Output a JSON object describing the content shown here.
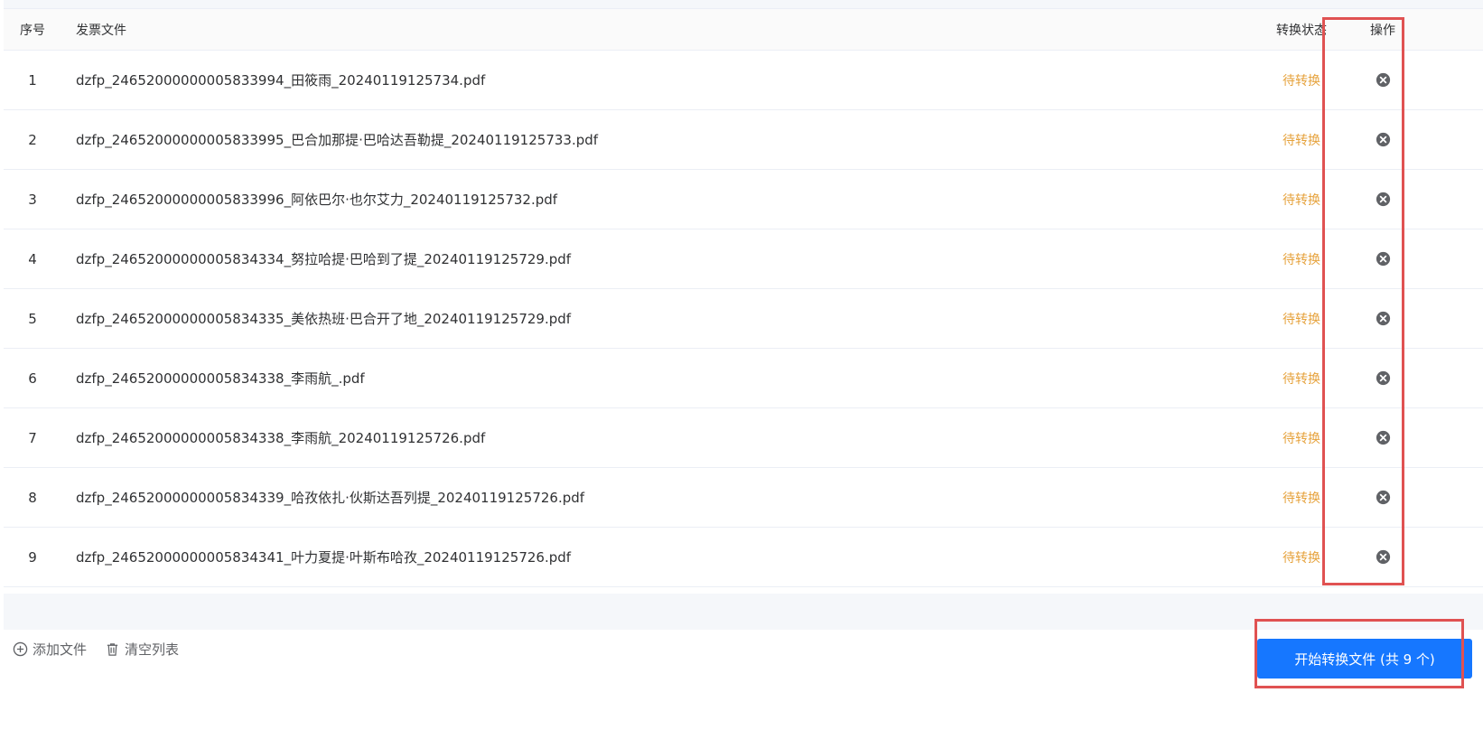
{
  "table": {
    "headers": {
      "index": "序号",
      "file": "发票文件",
      "status": "转换状态",
      "action": "操作"
    },
    "rows": [
      {
        "index": "1",
        "file": "dzfp_24652000000005833994_田筱雨_20240119125734.pdf",
        "status": "待转换"
      },
      {
        "index": "2",
        "file": "dzfp_24652000000005833995_巴合加那提·巴哈达吾勒提_20240119125733.pdf",
        "status": "待转换"
      },
      {
        "index": "3",
        "file": "dzfp_24652000000005833996_阿依巴尔·也尔艾力_20240119125732.pdf",
        "status": "待转换"
      },
      {
        "index": "4",
        "file": "dzfp_24652000000005834334_努拉哈提·巴哈到了提_20240119125729.pdf",
        "status": "待转换"
      },
      {
        "index": "5",
        "file": "dzfp_24652000000005834335_美依热班·巴合开了地_20240119125729.pdf",
        "status": "待转换"
      },
      {
        "index": "6",
        "file": "dzfp_24652000000005834338_李雨航_.pdf",
        "status": "待转换"
      },
      {
        "index": "7",
        "file": "dzfp_24652000000005834338_李雨航_20240119125726.pdf",
        "status": "待转换"
      },
      {
        "index": "8",
        "file": "dzfp_24652000000005834339_哈孜依扎·伙斯达吾列提_20240119125726.pdf",
        "status": "待转换"
      },
      {
        "index": "9",
        "file": "dzfp_24652000000005834341_叶力夏提·叶斯布哈孜_20240119125726.pdf",
        "status": "待转换"
      }
    ]
  },
  "footer": {
    "add_files": "添加文件",
    "clear_list": "清空列表",
    "start_button": "开始转换文件 (共 9 个)"
  },
  "colors": {
    "pending_status": "#e6a23c",
    "primary": "#1677ff",
    "highlight": "#e05252"
  },
  "icons": {
    "remove": "close-circle-icon",
    "add": "plus-circle-icon",
    "clear": "trash-icon"
  }
}
